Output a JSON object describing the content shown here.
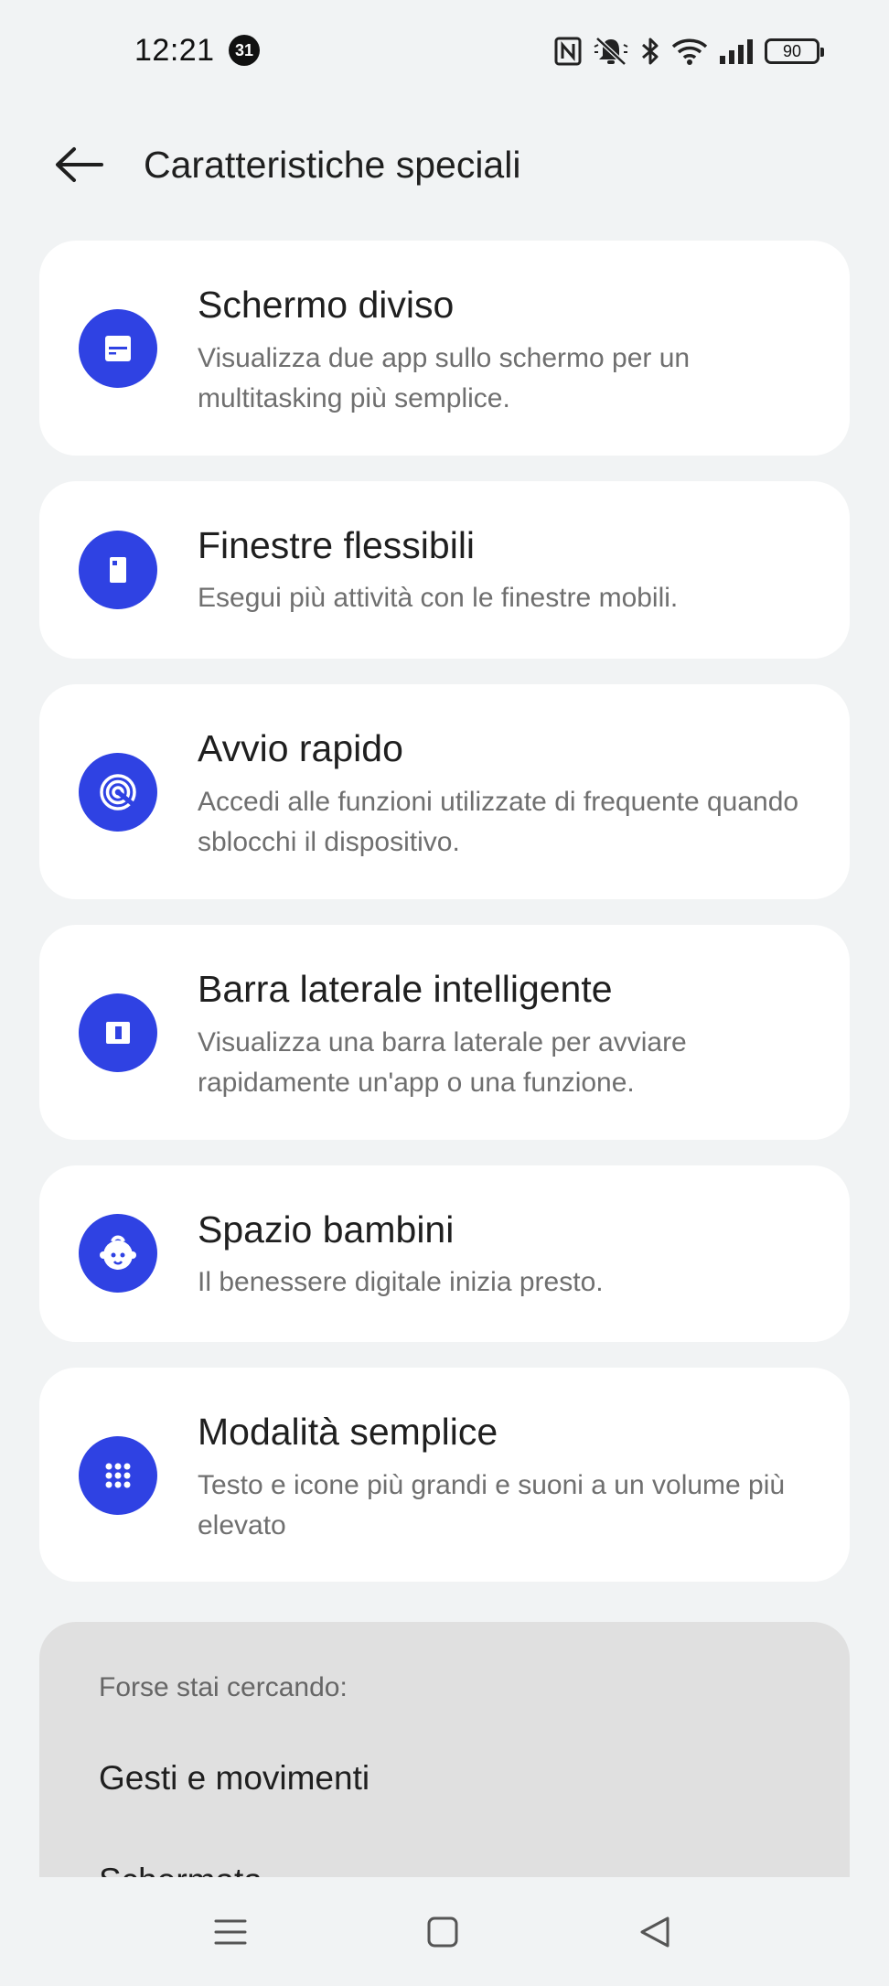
{
  "status_bar": {
    "time": "12:21",
    "notification_count": "31",
    "battery_level": "90",
    "icons": [
      "nfc-icon",
      "muted-bell-icon",
      "bluetooth-icon",
      "wifi-icon",
      "signal-icon",
      "battery-icon"
    ]
  },
  "header": {
    "title": "Caratteristiche speciali",
    "back_icon": "arrow-left-icon"
  },
  "features": [
    {
      "title": "Schermo diviso",
      "description": "Visualizza due app sullo schermo per un multitasking più semplice.",
      "icon": "split-screen-icon"
    },
    {
      "title": "Finestre flessibili",
      "description": "Esegui più attività con le finestre mobili.",
      "icon": "flexible-window-icon"
    },
    {
      "title": "Avvio rapido",
      "description": "Accedi alle funzioni utilizzate di frequente quando sblocchi il dispositivo.",
      "icon": "fingerprint-icon"
    },
    {
      "title": "Barra laterale intelligente",
      "description": "Visualizza una barra laterale per avviare rapidamente un'app o una funzione.",
      "icon": "sidebar-icon"
    },
    {
      "title": "Spazio bambini",
      "description": "Il benessere digitale inizia presto.",
      "icon": "kid-face-icon"
    },
    {
      "title": "Modalità semplice",
      "description": "Testo e icone più grandi e suoni a un volume più elevato",
      "icon": "grid-dots-icon"
    }
  ],
  "suggestions": {
    "title": "Forse stai cercando:",
    "items": [
      "Gesti e movimenti",
      "Schermata"
    ]
  },
  "nav_bar": {
    "icons": [
      "menu-icon",
      "home-icon",
      "back-triangle-icon"
    ]
  },
  "colors": {
    "accent": "#2f42e3",
    "background": "#f1f3f4",
    "card": "#ffffff",
    "suggest_panel": "#e0e0e0"
  }
}
